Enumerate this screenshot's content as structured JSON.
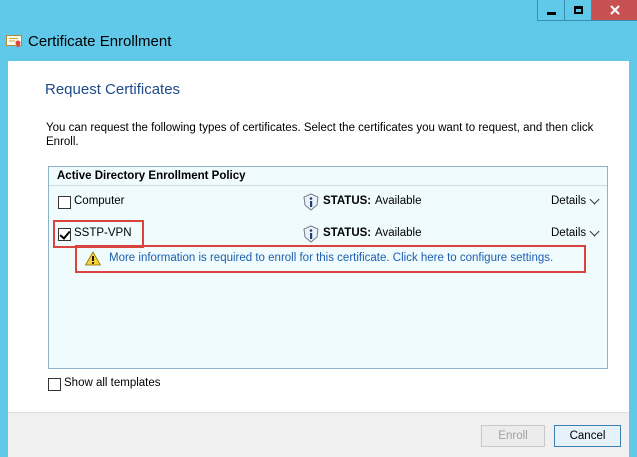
{
  "window": {
    "title": "Certificate Enrollment",
    "controls": {
      "minimize": "minimize",
      "maximize": "maximize",
      "close": "close"
    }
  },
  "page": {
    "heading": "Request Certificates",
    "description": "You can request the following types of certificates. Select the certificates you want to request, and then click Enroll."
  },
  "policy": {
    "header": "Active Directory Enrollment Policy",
    "certificates": [
      {
        "name": "Computer",
        "checked": false,
        "status_label": "STATUS:",
        "status_value": "Available",
        "details_label": "Details"
      },
      {
        "name": "SSTP-VPN",
        "checked": true,
        "status_label": "STATUS:",
        "status_value": "Available",
        "details_label": "Details"
      }
    ],
    "warning_link": "More information is required to enroll for this certificate. Click here to configure settings."
  },
  "options": {
    "show_all_label": "Show all templates",
    "show_all_checked": false
  },
  "footer": {
    "enroll_label": "Enroll",
    "cancel_label": "Cancel"
  },
  "colors": {
    "desktop": "#60c8e9",
    "heading": "#1e4b8a",
    "link": "#1e5fb0",
    "highlight": "#d9443f",
    "panel": "#effbfc"
  },
  "icons": {
    "title": "certificate-icon",
    "status": "info-status-icon",
    "warning": "warning-icon",
    "chevron": "chevron-down-icon"
  }
}
